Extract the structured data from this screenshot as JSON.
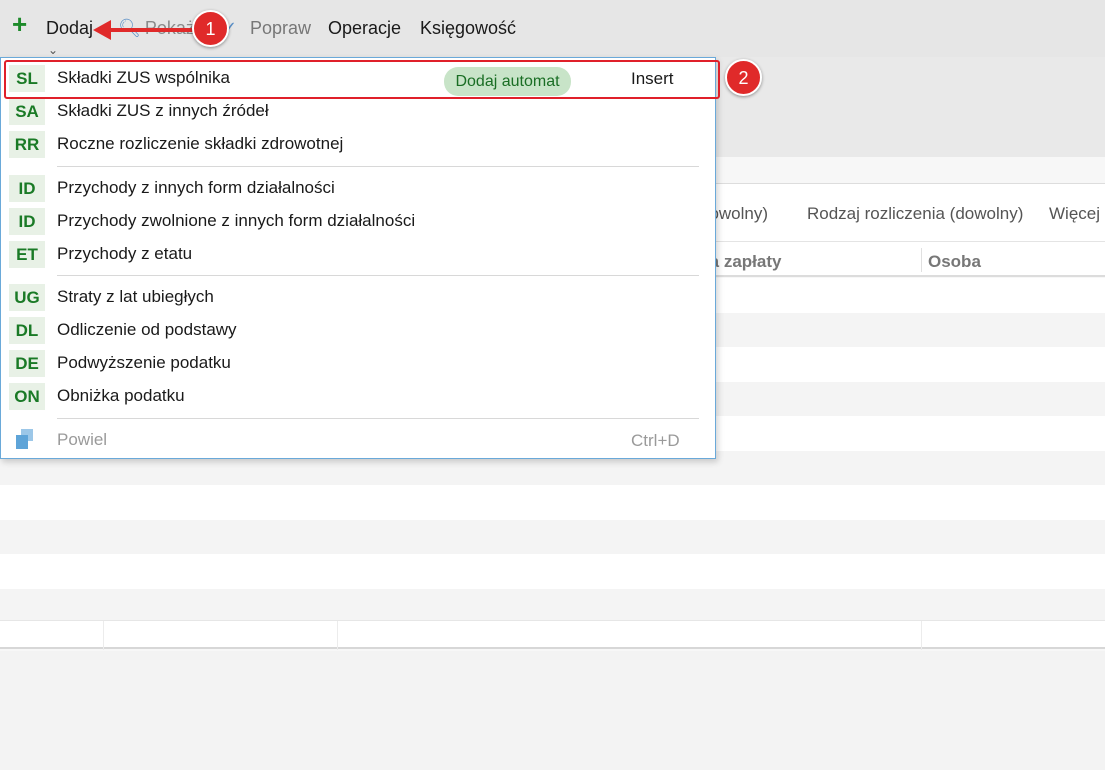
{
  "toolbar": {
    "add_label": "Dodaj",
    "show_label": "Pokaż",
    "fix_label": "Popraw",
    "operations_label": "Operacje",
    "accounting_label": "Księgowość"
  },
  "filters": [
    "dowolny)",
    "Rodzaj rozliczenia (dowolny)",
    "Więcej"
  ],
  "columns": [
    "ta zapłaty",
    "Osoba"
  ],
  "menu": {
    "groups": [
      [
        {
          "code": "SL",
          "label": "Składki ZUS wspólnika",
          "badge": "Dodaj automat",
          "shortcut": "Insert"
        },
        {
          "code": "SA",
          "label": "Składki ZUS z innych źródeł"
        },
        {
          "code": "RR",
          "label": "Roczne rozliczenie składki zdrowotnej"
        }
      ],
      [
        {
          "code": "ID",
          "label": "Przychody z innych form działalności"
        },
        {
          "code": "ID",
          "label": "Przychody zwolnione z innych form działalności"
        },
        {
          "code": "ET",
          "label": "Przychody z etatu"
        }
      ],
      [
        {
          "code": "UG",
          "label": "Straty z lat ubiegłych"
        },
        {
          "code": "DL",
          "label": "Odliczenie od podstawy"
        },
        {
          "code": "DE",
          "label": "Podwyższenie podatku"
        },
        {
          "code": "ON",
          "label": "Obniżka podatku"
        }
      ]
    ],
    "duplicate": {
      "label": "Powiel",
      "shortcut": "Ctrl+D",
      "icon": "duplicate-icon"
    }
  },
  "callouts": [
    "1",
    "2"
  ],
  "colors": {
    "accent_green": "#1d8a2a",
    "callout_red": "#e02a2a",
    "menu_border": "#6aa9d9"
  }
}
